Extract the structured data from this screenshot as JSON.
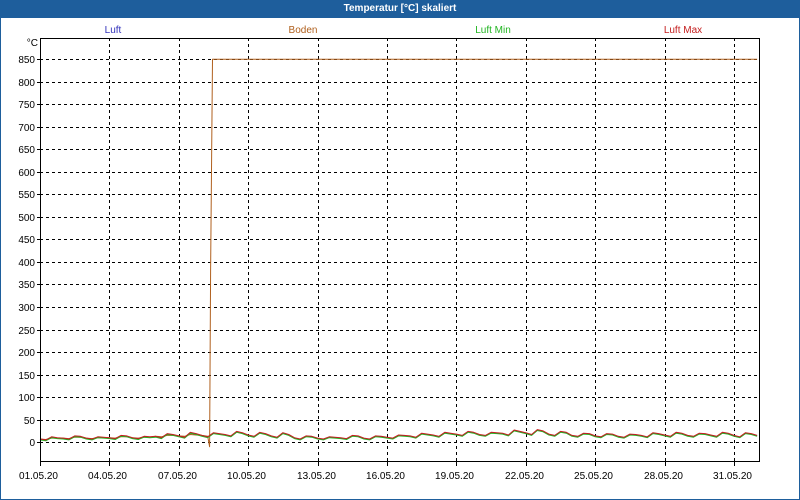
{
  "colors": {
    "title_bar": "#1e5e9c",
    "title_text": "#ffffff",
    "background": "#ffffff"
  },
  "chart_data": {
    "type": "line",
    "title": "Temperatur [°C] skaliert",
    "ylabel": "°C",
    "xlim": [
      "01.05.20 00:00",
      "01.06.20 03:00"
    ],
    "ylim": [
      -44,
      897
    ],
    "x_ticks": [
      "01.05.20",
      "04.05.20",
      "07.05.20",
      "10.05.20",
      "13.05.20",
      "16.05.20",
      "19.05.20",
      "22.05.20",
      "25.05.20",
      "28.05.20",
      "31.05.20"
    ],
    "y_ticks": [
      0,
      50,
      100,
      150,
      200,
      250,
      300,
      350,
      400,
      450,
      500,
      550,
      600,
      650,
      700,
      750,
      800,
      850
    ],
    "grid": true,
    "legend_position": "top",
    "x": [
      "01.05.20 00:00",
      "01.05.20 06:00",
      "01.05.20 12:00",
      "01.05.20 18:00",
      "02.05.20 00:00",
      "02.05.20 06:00",
      "02.05.20 12:00",
      "02.05.20 18:00",
      "03.05.20 00:00",
      "03.05.20 06:00",
      "03.05.20 12:00",
      "03.05.20 18:00",
      "04.05.20 00:00",
      "04.05.20 06:00",
      "04.05.20 12:00",
      "04.05.20 18:00",
      "05.05.20 00:00",
      "05.05.20 06:00",
      "05.05.20 12:00",
      "05.05.20 18:00",
      "06.05.20 00:00",
      "06.05.20 06:00",
      "06.05.20 12:00",
      "06.05.20 18:00",
      "07.05.20 00:00",
      "07.05.20 06:00",
      "07.05.20 12:00",
      "07.05.20 18:00",
      "08.05.20 00:00",
      "08.05.20 06:00",
      "08.05.20 12:00",
      "08.05.20 18:00",
      "09.05.20 00:00",
      "09.05.20 06:00",
      "09.05.20 12:00",
      "09.05.20 18:00",
      "10.05.20 00:00",
      "10.05.20 06:00",
      "10.05.20 12:00",
      "10.05.20 18:00",
      "11.05.20 00:00",
      "11.05.20 06:00",
      "11.05.20 12:00",
      "11.05.20 18:00",
      "12.05.20 00:00",
      "12.05.20 06:00",
      "12.05.20 12:00",
      "12.05.20 18:00",
      "13.05.20 00:00",
      "13.05.20 06:00",
      "13.05.20 12:00",
      "13.05.20 18:00",
      "14.05.20 00:00",
      "14.05.20 06:00",
      "14.05.20 12:00",
      "14.05.20 18:00",
      "15.05.20 00:00",
      "15.05.20 06:00",
      "15.05.20 12:00",
      "15.05.20 18:00",
      "16.05.20 00:00",
      "16.05.20 06:00",
      "16.05.20 12:00",
      "16.05.20 18:00",
      "17.05.20 00:00",
      "17.05.20 06:00",
      "17.05.20 12:00",
      "17.05.20 18:00",
      "18.05.20 00:00",
      "18.05.20 06:00",
      "18.05.20 12:00",
      "18.05.20 18:00",
      "19.05.20 00:00",
      "19.05.20 06:00",
      "19.05.20 12:00",
      "19.05.20 18:00",
      "20.05.20 00:00",
      "20.05.20 06:00",
      "20.05.20 12:00",
      "20.05.20 18:00",
      "21.05.20 00:00",
      "21.05.20 06:00",
      "21.05.20 12:00",
      "21.05.20 18:00",
      "22.05.20 00:00",
      "22.05.20 06:00",
      "22.05.20 12:00",
      "22.05.20 18:00",
      "23.05.20 00:00",
      "23.05.20 06:00",
      "23.05.20 12:00",
      "23.05.20 18:00",
      "24.05.20 00:00",
      "24.05.20 06:00",
      "24.05.20 12:00",
      "24.05.20 18:00",
      "25.05.20 00:00",
      "25.05.20 06:00",
      "25.05.20 12:00",
      "25.05.20 18:00",
      "26.05.20 00:00",
      "26.05.20 06:00",
      "26.05.20 12:00",
      "26.05.20 18:00",
      "27.05.20 00:00",
      "27.05.20 06:00",
      "27.05.20 12:00",
      "27.05.20 18:00",
      "28.05.20 00:00",
      "28.05.20 06:00",
      "28.05.20 12:00",
      "28.05.20 18:00",
      "29.05.20 00:00",
      "29.05.20 06:00",
      "29.05.20 12:00",
      "29.05.20 18:00",
      "30.05.20 00:00",
      "30.05.20 06:00",
      "30.05.20 12:00",
      "30.05.20 18:00",
      "31.05.20 00:00",
      "31.05.20 06:00",
      "31.05.20 12:00",
      "31.05.20 18:00",
      "01.06.20 00:00"
    ],
    "series": [
      {
        "name": "Luft",
        "color": "#3333bb",
        "values": [
          6,
          4,
          11,
          9,
          8,
          6,
          13,
          12,
          8,
          6,
          11,
          10,
          9,
          7,
          14,
          13,
          9,
          7,
          12,
          11,
          12,
          9,
          18,
          16,
          13,
          10,
          21,
          18,
          14,
          11,
          20,
          18,
          16,
          13,
          23,
          20,
          15,
          12,
          21,
          18,
          13,
          10,
          20,
          16,
          9,
          6,
          13,
          12,
          8,
          6,
          11,
          10,
          9,
          7,
          14,
          13,
          8,
          6,
          13,
          12,
          10,
          8,
          15,
          14,
          13,
          10,
          19,
          17,
          15,
          12,
          21,
          19,
          17,
          14,
          23,
          21,
          16,
          14,
          21,
          20,
          19,
          15,
          26,
          23,
          20,
          16,
          27,
          24,
          17,
          14,
          23,
          21,
          14,
          12,
          19,
          18,
          13,
          11,
          18,
          17,
          12,
          10,
          17,
          16,
          14,
          11,
          20,
          18,
          15,
          12,
          21,
          19,
          14,
          12,
          19,
          18,
          15,
          12,
          21,
          19,
          14,
          11,
          20,
          18,
          14
        ]
      },
      {
        "name": "Boden",
        "color": "#b0601e",
        "x": [
          "01.05.20 00:00",
          "01.05.20 06:00",
          "01.05.20 12:00",
          "01.05.20 18:00",
          "02.05.20 00:00",
          "02.05.20 06:00",
          "02.05.20 12:00",
          "02.05.20 18:00",
          "03.05.20 00:00",
          "03.05.20 06:00",
          "03.05.20 12:00",
          "03.05.20 18:00",
          "04.05.20 00:00",
          "04.05.20 06:00",
          "04.05.20 12:00",
          "04.05.20 18:00",
          "05.05.20 00:00",
          "05.05.20 06:00",
          "05.05.20 12:00",
          "05.05.20 18:00",
          "06.05.20 00:00",
          "06.05.20 06:00",
          "06.05.20 12:00",
          "06.05.20 18:00",
          "07.05.20 00:00",
          "07.05.20 06:00",
          "07.05.20 12:00",
          "07.05.20 18:00",
          "08.05.20 00:00",
          "08.05.20 06:00",
          "08.05.20 08:00",
          "08.05.20 09:00",
          "08.05.20 11:00",
          "01.06.20 00:00"
        ],
        "values": [
          7,
          6,
          9,
          9,
          9,
          8,
          11,
          11,
          9,
          8,
          10,
          10,
          10,
          9,
          12,
          12,
          10,
          9,
          11,
          11,
          13,
          12,
          15,
          15,
          14,
          13,
          17,
          16,
          15,
          13,
          -10,
          380,
          850,
          850
        ]
      },
      {
        "name": "Luft Min",
        "color": "#22b522",
        "values": [
          5,
          3,
          10,
          8,
          7,
          5,
          12,
          11,
          7,
          5,
          10,
          9,
          8,
          6,
          13,
          12,
          8,
          6,
          11,
          10,
          11,
          8,
          17,
          15,
          12,
          9,
          20,
          17,
          13,
          10,
          19,
          17,
          15,
          12,
          22,
          19,
          14,
          11,
          20,
          17,
          12,
          9,
          19,
          15,
          8,
          5,
          12,
          11,
          7,
          5,
          10,
          9,
          8,
          6,
          13,
          12,
          7,
          5,
          12,
          11,
          9,
          7,
          14,
          13,
          12,
          9,
          18,
          16,
          14,
          11,
          20,
          18,
          16,
          13,
          22,
          20,
          15,
          13,
          20,
          19,
          18,
          14,
          25,
          22,
          19,
          15,
          26,
          23,
          16,
          13,
          22,
          20,
          13,
          11,
          18,
          17,
          12,
          10,
          17,
          16,
          11,
          9,
          16,
          15,
          13,
          10,
          19,
          17,
          14,
          11,
          20,
          18,
          13,
          11,
          18,
          17,
          14,
          11,
          20,
          18,
          13,
          10,
          19,
          17,
          13
        ]
      },
      {
        "name": "Luft Max",
        "color": "#c42020",
        "values": [
          7,
          5,
          12,
          10,
          9,
          7,
          14,
          13,
          9,
          7,
          12,
          11,
          10,
          8,
          15,
          14,
          10,
          8,
          13,
          12,
          13,
          10,
          19,
          17,
          14,
          11,
          22,
          19,
          15,
          12,
          21,
          19,
          17,
          14,
          24,
          21,
          16,
          13,
          22,
          19,
          14,
          11,
          21,
          17,
          10,
          7,
          14,
          13,
          9,
          7,
          12,
          11,
          10,
          8,
          15,
          14,
          9,
          7,
          14,
          13,
          11,
          9,
          16,
          15,
          14,
          11,
          20,
          18,
          16,
          13,
          22,
          20,
          18,
          15,
          24,
          22,
          17,
          15,
          22,
          21,
          20,
          16,
          27,
          24,
          21,
          17,
          28,
          25,
          18,
          15,
          24,
          22,
          15,
          13,
          20,
          19,
          14,
          12,
          19,
          18,
          13,
          11,
          18,
          17,
          15,
          12,
          21,
          19,
          16,
          13,
          22,
          20,
          15,
          13,
          20,
          19,
          16,
          13,
          22,
          20,
          15,
          12,
          21,
          19,
          15
        ]
      }
    ]
  }
}
